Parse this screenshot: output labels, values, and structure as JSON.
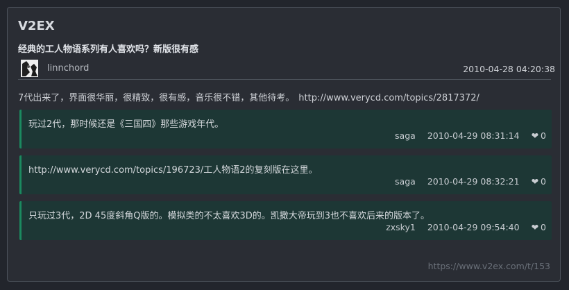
{
  "site": {
    "name": "V2EX"
  },
  "topic": {
    "title": "经典的工人物语系列有人喜欢吗？新版很有感",
    "author": "linnchord",
    "time": "2010-04-28 04:20:38",
    "content": "7代出来了，界面很华丽，很精致，很有感，音乐很不错，其他待考。",
    "content_link": "http://www.verycd.com/topics/2817372/"
  },
  "replies": [
    {
      "text": "玩过2代，那时候还是《三国四》那些游戏年代。",
      "user": "saga",
      "time": "2010-04-29 08:31:14",
      "heart_icon": "heart-icon",
      "likes": "0"
    },
    {
      "text": "http://www.verycd.com/topics/196723/工人物语2的复刻版在这里。",
      "user": "saga",
      "time": "2010-04-29 08:32:21",
      "heart_icon": "heart-icon",
      "likes": "0"
    },
    {
      "text": "只玩过3代，2D 45度斜角Q版的。模拟类的不太喜欢3D的。凯撒大帝玩到3也不喜欢后来的版本了。",
      "user": "zxsky1",
      "time": "2010-04-29 09:54:40",
      "heart_icon": "heart-icon",
      "likes": "0"
    }
  ],
  "footer": {
    "url": "https://www.v2ex.com/t/153"
  },
  "colors": {
    "background": "#22252c",
    "card": "#2a2d34",
    "reply_bg": "#1d3735",
    "reply_accent": "#1b8a60",
    "muted": "#6a7079"
  }
}
